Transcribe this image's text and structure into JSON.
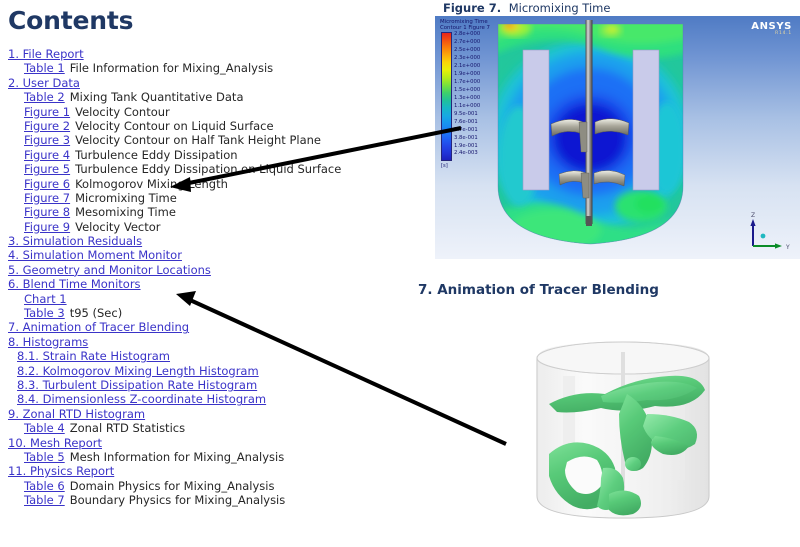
{
  "contents": {
    "heading": "Contents",
    "entries": [
      {
        "indent": 0,
        "link": "1. File Report",
        "desc": ""
      },
      {
        "indent": 1,
        "link": "Table 1",
        "desc": "File Information for Mixing_Analysis"
      },
      {
        "indent": 0,
        "link": "2. User Data",
        "desc": ""
      },
      {
        "indent": 1,
        "link": "Table 2",
        "desc": "Mixing Tank Quantitative Data"
      },
      {
        "indent": 1,
        "link": "Figure 1",
        "desc": "Velocity Contour"
      },
      {
        "indent": 1,
        "link": "Figure 2",
        "desc": "Velocity Contour on Liquid Surface"
      },
      {
        "indent": 1,
        "link": "Figure 3",
        "desc": "Velocity Contour on Half Tank Height Plane"
      },
      {
        "indent": 1,
        "link": "Figure 4",
        "desc": "Turbulence Eddy Dissipation"
      },
      {
        "indent": 1,
        "link": "Figure 5",
        "desc": "Turbulence Eddy Dissipation on Liquid Surface"
      },
      {
        "indent": 1,
        "link": "Figure 6",
        "desc": "Kolmogorov Mixing Length"
      },
      {
        "indent": 1,
        "link": "Figure 7",
        "desc": "Micromixing Time"
      },
      {
        "indent": 1,
        "link": "Figure 8",
        "desc": "Mesomixing Time"
      },
      {
        "indent": 1,
        "link": "Figure 9",
        "desc": "Velocity Vector"
      },
      {
        "indent": 0,
        "link": "3. Simulation Residuals",
        "desc": ""
      },
      {
        "indent": 0,
        "link": "4. Simulation Moment Monitor",
        "desc": ""
      },
      {
        "indent": 0,
        "link": "5. Geometry and Monitor Locations",
        "desc": ""
      },
      {
        "indent": 0,
        "link": "6. Blend Time Monitors",
        "desc": ""
      },
      {
        "indent": 1,
        "link": "Chart 1",
        "desc": ""
      },
      {
        "indent": 1,
        "link": "Table 3",
        "desc": "t95 (Sec)"
      },
      {
        "indent": 0,
        "link": "7. Animation of Tracer Blending",
        "desc": ""
      },
      {
        "indent": 0,
        "link": "8. Histograms",
        "desc": ""
      },
      {
        "indent": 2,
        "link": "8.1. Strain Rate Histogram",
        "desc": ""
      },
      {
        "indent": 2,
        "link": "8.2. Kolmogorov Mixing Length Histogram",
        "desc": ""
      },
      {
        "indent": 2,
        "link": "8.3. Turbulent Dissipation Rate Histogram",
        "desc": ""
      },
      {
        "indent": 2,
        "link": "8.4. Dimensionless Z-coordinate Histogram",
        "desc": ""
      },
      {
        "indent": 0,
        "link": "9. Zonal RTD Histogram",
        "desc": ""
      },
      {
        "indent": 1,
        "link": "Table 4",
        "desc": "Zonal RTD Statistics"
      },
      {
        "indent": 0,
        "link": "10. Mesh Report",
        "desc": ""
      },
      {
        "indent": 1,
        "link": "Table 5",
        "desc": "Mesh Information for Mixing_Analysis"
      },
      {
        "indent": 0,
        "link": "11. Physics Report",
        "desc": ""
      },
      {
        "indent": 1,
        "link": "Table 6",
        "desc": "Domain Physics for Mixing_Analysis"
      },
      {
        "indent": 1,
        "link": "Table 7",
        "desc": "Boundary Physics for Mixing_Analysis"
      }
    ]
  },
  "figure7": {
    "caption_number": "Figure 7.",
    "caption_text": "Micromixing Time",
    "legend": {
      "title_line1": "Micromixing Time",
      "title_line2": "Contour 1 Figure 7",
      "unit": "[s]",
      "values": [
        "2.8e+000",
        "2.7e+000",
        "2.5e+000",
        "2.3e+000",
        "2.1e+000",
        "1.9e+000",
        "1.7e+000",
        "1.5e+000",
        "1.3e+000",
        "1.1e+000",
        "9.5e-001",
        "7.6e-001",
        "5.7e-001",
        "3.8e-001",
        "1.9e-001",
        "2.4e-003"
      ]
    },
    "branding": {
      "name": "ANSYS",
      "version": "R14.1"
    },
    "axes": {
      "z": "Z",
      "y": "Y"
    }
  },
  "section7": {
    "caption": "7. Animation of Tracer Blending"
  },
  "colors": {
    "link": "#3a33c8",
    "heading": "#1f3864",
    "legend_high": "#e8241c",
    "legend_low": "#1d21bd",
    "tracer": "#4cc46a"
  }
}
